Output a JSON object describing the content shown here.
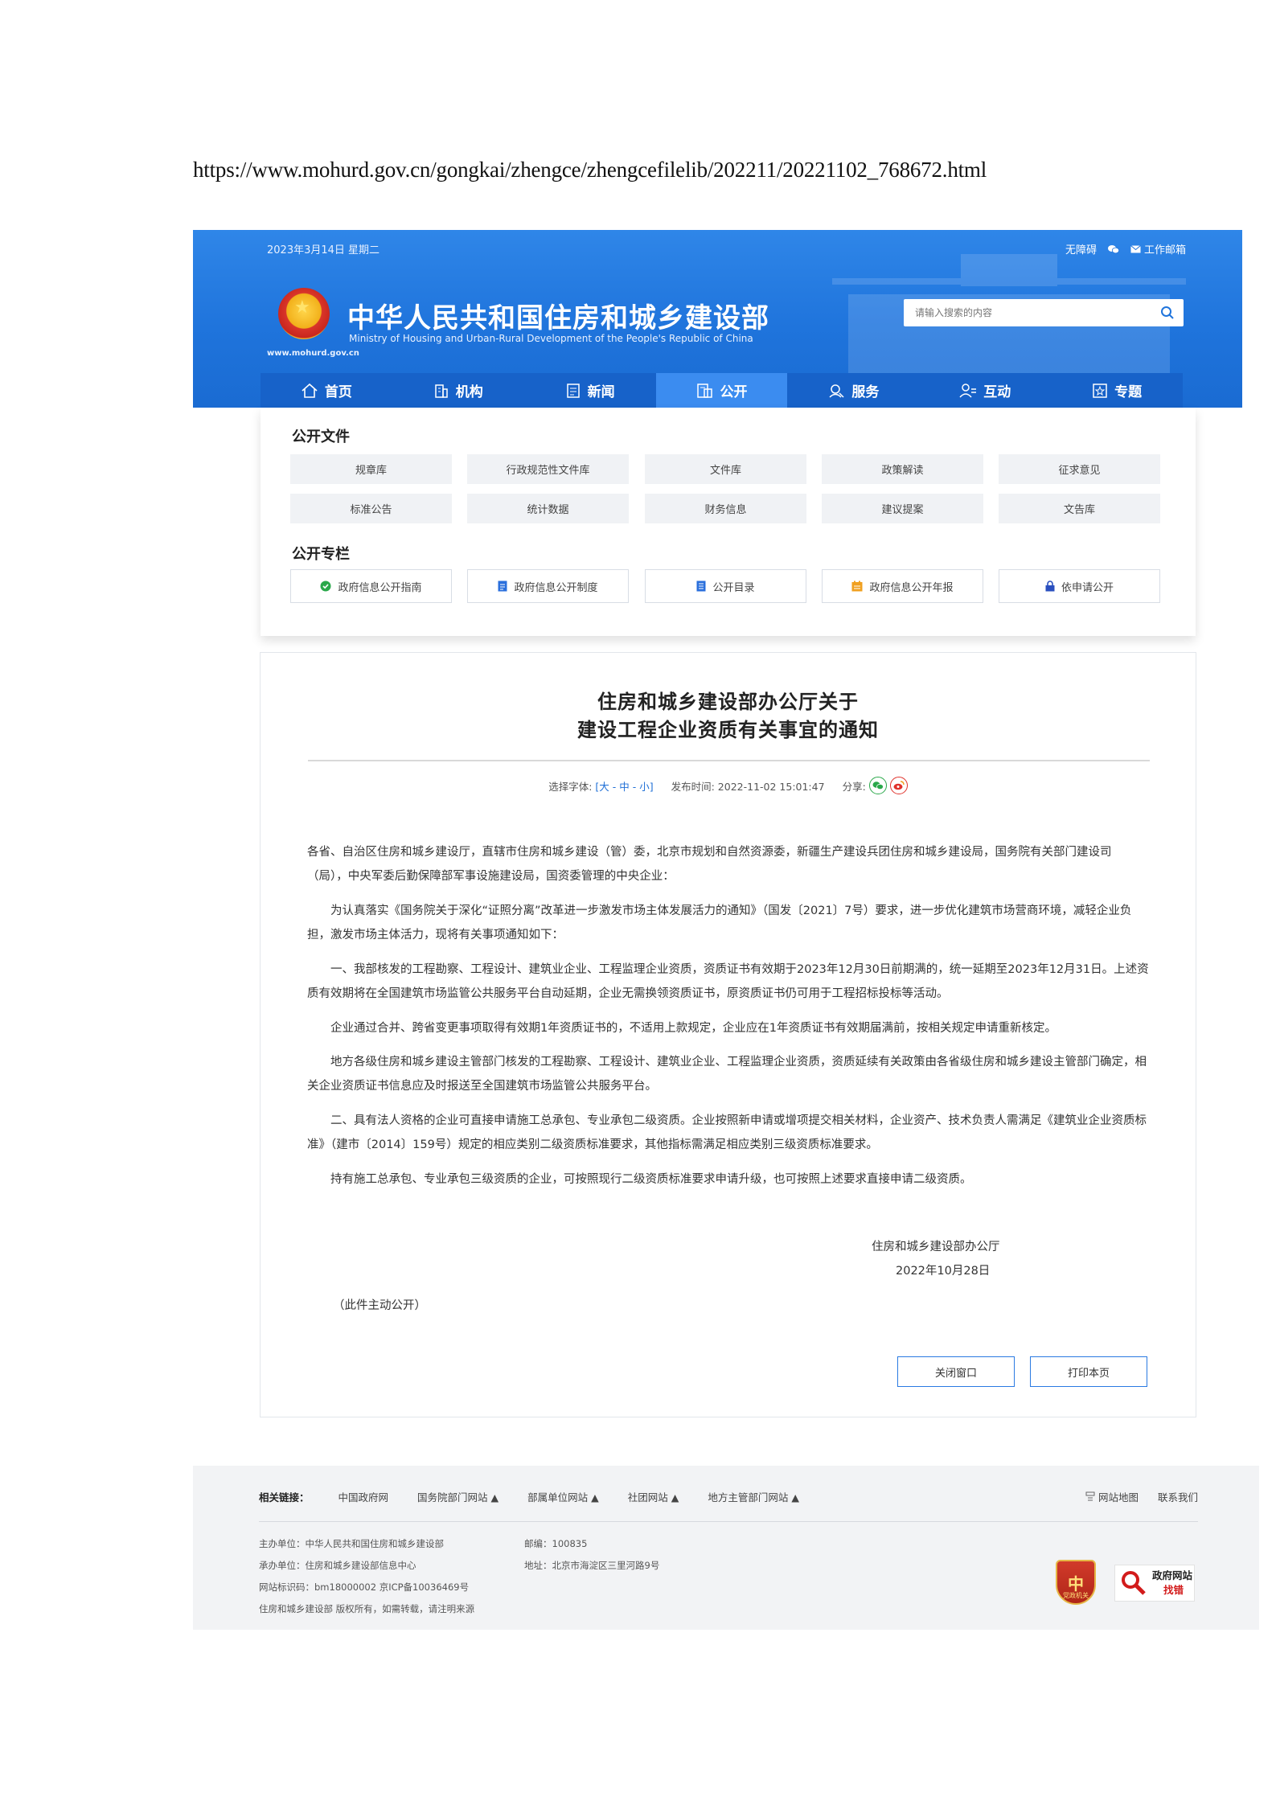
{
  "url": "https://www.mohurd.gov.cn/gongkai/zhengce/zhengcefilelib/202211/20221102_768672.html",
  "header": {
    "date": "2023年3月14日 星期二",
    "top_links": [
      "无障碍",
      "工作邮箱"
    ],
    "site_url": "www.mohurd.gov.cn",
    "title_cn": "中华人民共和国住房和城乡建设部",
    "title_en": "Ministry of Housing and Urban-Rural Development of the People's Republic of China",
    "search_placeholder": "请输入搜索的内容"
  },
  "nav": {
    "items": [
      {
        "label": "首页",
        "icon": "home-icon"
      },
      {
        "label": "机构",
        "icon": "building-icon"
      },
      {
        "label": "新闻",
        "icon": "news-icon"
      },
      {
        "label": "公开",
        "icon": "open-doc-icon",
        "active": true
      },
      {
        "label": "服务",
        "icon": "service-icon"
      },
      {
        "label": "互动",
        "icon": "interact-icon"
      },
      {
        "label": "专题",
        "icon": "topic-icon"
      }
    ]
  },
  "public_docs": {
    "title": "公开文件",
    "items": [
      "规章库",
      "行政规范性文件库",
      "文件库",
      "政策解读",
      "征求意见",
      "标准公告",
      "统计数据",
      "财务信息",
      "建议提案",
      "文告库"
    ]
  },
  "public_columns": {
    "title": "公开专栏",
    "items": [
      {
        "label": "政府信息公开指南",
        "icon": "check-circle-icon",
        "color": "#2aa84a"
      },
      {
        "label": "政府信息公开制度",
        "icon": "document-icon",
        "color": "#2a6fdc"
      },
      {
        "label": "公开目录",
        "icon": "catalog-icon",
        "color": "#2a6fdc"
      },
      {
        "label": "政府信息公开年报",
        "icon": "calendar-icon",
        "color": "#f0a020"
      },
      {
        "label": "依申请公开",
        "icon": "lock-icon",
        "color": "#2a4fbf"
      }
    ]
  },
  "article": {
    "title_line1": "住房和城乡建设部办公厅关于",
    "title_line2": "建设工程企业资质有关事宜的通知",
    "font_label": "选择字体:",
    "font_sizes": "[大 - 中 - 小]",
    "publish_label": "发布时间:",
    "publish_time": "2022-11-02 15:01:47",
    "share_label": "分享:",
    "paragraphs": [
      "各省、自治区住房和城乡建设厅，直辖市住房和城乡建设（管）委，北京市规划和自然资源委，新疆生产建设兵团住房和城乡建设局，国务院有关部门建设司（局），中央军委后勤保障部军事设施建设局，国资委管理的中央企业：",
      "为认真落实《国务院关于深化“证照分离”改革进一步激发市场主体发展活力的通知》（国发〔2021〕7号）要求，进一步优化建筑市场营商环境，减轻企业负担，激发市场主体活力，现将有关事项通知如下：",
      "一、我部核发的工程勘察、工程设计、建筑业企业、工程监理企业资质，资质证书有效期于2023年12月30日前期满的，统一延期至2023年12月31日。上述资质有效期将在全国建筑市场监管公共服务平台自动延期，企业无需换领资质证书，原资质证书仍可用于工程招标投标等活动。",
      "企业通过合并、跨省变更事项取得有效期1年资质证书的，不适用上款规定，企业应在1年资质证书有效期届满前，按相关规定申请重新核定。",
      "地方各级住房和城乡建设主管部门核发的工程勘察、工程设计、建筑业企业、工程监理企业资质，资质延续有关政策由各省级住房和城乡建设主管部门确定，相关企业资质证书信息应及时报送至全国建筑市场监管公共服务平台。",
      "二、具有法人资格的企业可直接申请施工总承包、专业承包二级资质。企业按照新申请或增项提交相关材料，企业资产、技术负责人需满足《建筑业企业资质标准》（建市〔2014〕159号）规定的相应类别二级资质标准要求，其他指标需满足相应类别三级资质标准要求。",
      "持有施工总承包、专业承包三级资质的企业，可按照现行二级资质标准要求申请升级，也可按照上述要求直接申请二级资质。"
    ],
    "signer": "住房和城乡建设部办公厅",
    "sign_date": "2022年10月28日",
    "note": "（此件主动公开）",
    "close_button": "关闭窗口",
    "print_button": "打印本页"
  },
  "footer": {
    "related_label": "相关链接：",
    "links": [
      "中国政府网",
      "国务院部门网站",
      "部属单位网站",
      "社团网站",
      "地方主管部门网站"
    ],
    "right_links": [
      "网站地图",
      "联系我们"
    ],
    "info_left": [
      "主办单位：中华人民共和国住房和城乡建设部",
      "承办单位：住房和城乡建设部信息中心",
      "网站标识码：bm18000002    京ICP备10036469号",
      "住房和城乡建设部 版权所有，如需转载，请注明来源"
    ],
    "info_right": [
      "邮编：100835",
      "地址：北京市海淀区三里河路9号"
    ],
    "badge1_text": "党政机关",
    "badge2_line1": "政府网站",
    "badge2_line2": "找错"
  }
}
